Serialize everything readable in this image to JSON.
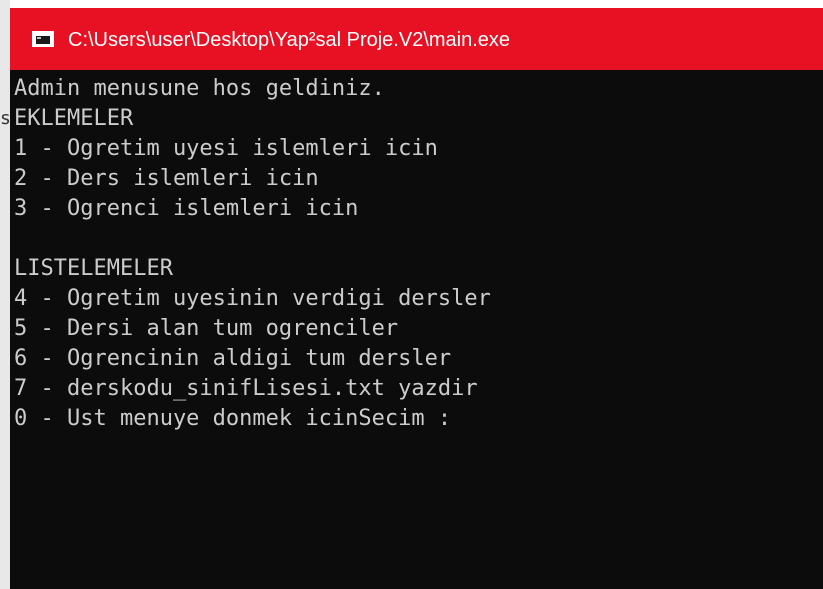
{
  "window": {
    "title": "C:\\Users\\user\\Desktop\\Yap²sal Proje.V2\\main.exe",
    "titlebar_color": "#e81123",
    "icon": "console-app-icon"
  },
  "console": {
    "lines": [
      "Admin menusune hos geldiniz.",
      "EKLEMELER",
      "1 - Ogretim uyesi islemleri icin",
      "2 - Ders islemleri icin",
      "3 - Ogrenci islemleri icin",
      "",
      "LISTELEMELER",
      "4 - Ogretim uyesinin verdigi dersler",
      "5 - Dersi alan tum ogrenciler",
      "6 - Ogrencinin aldigi tum dersler",
      "7 - derskodu_sinifLisesi.txt yazdir",
      "0 - Ust menuye donmek icinSecim :"
    ],
    "background": "#0c0c0c",
    "foreground": "#cccccc"
  },
  "background_fragment": {
    "text": "s"
  }
}
